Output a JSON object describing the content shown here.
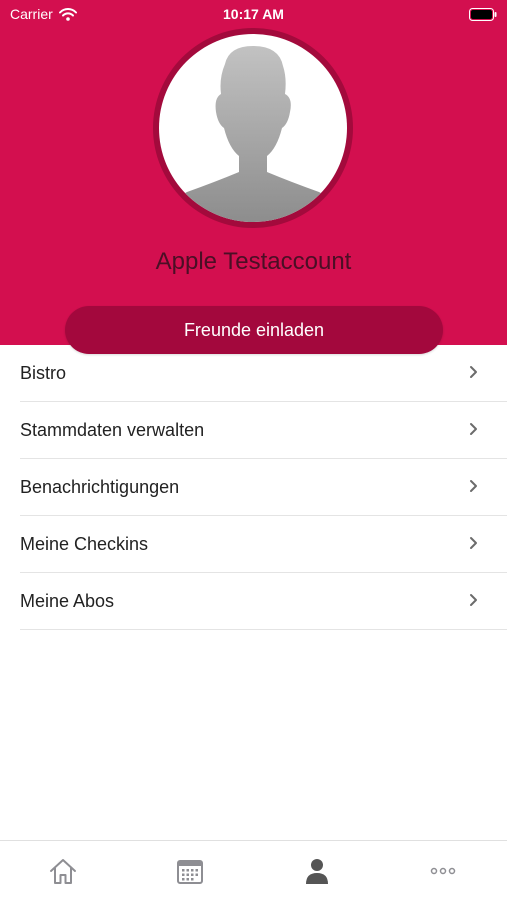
{
  "status_bar": {
    "carrier": "Carrier",
    "time": "10:17 AM",
    "wifi_icon": "wifi-icon",
    "battery_icon": "battery-icon"
  },
  "profile": {
    "name": "Apple Testaccount",
    "avatar_icon": "person-silhouette-icon",
    "invite_label": "Freunde einladen"
  },
  "menu": {
    "items": [
      {
        "label": "Bistro"
      },
      {
        "label": "Stammdaten verwalten"
      },
      {
        "label": "Benachrichtigungen"
      },
      {
        "label": "Meine Checkins"
      },
      {
        "label": "Meine Abos"
      }
    ],
    "chevron_icon": "chevron-right-icon"
  },
  "tabbar": {
    "tabs": [
      {
        "icon": "home-icon",
        "active": false
      },
      {
        "icon": "calendar-icon",
        "active": false
      },
      {
        "icon": "person-icon",
        "active": true
      },
      {
        "icon": "more-icon",
        "active": false
      }
    ]
  },
  "colors": {
    "brand": "#d30f4f",
    "brand_dark": "#a3083d",
    "tab_inactive": "#8e8e93",
    "tab_active": "#555555"
  }
}
